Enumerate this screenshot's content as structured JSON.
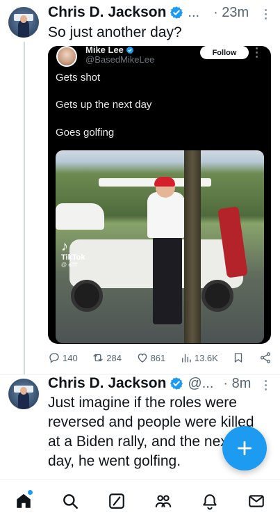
{
  "colors": {
    "accent": "#1d9bf0",
    "text": "#0f1419",
    "secondary": "#536471",
    "verified": "#1d9bf0"
  },
  "tweet1": {
    "author_name": "Chris D. Jackson",
    "handle": "...",
    "time": "· 23m",
    "text": "So just another day?",
    "quoted": {
      "author_name": "Mike Lee",
      "handle": "@BasedMikeLee",
      "follow_label": "Follow",
      "lines": [
        "Gets shot",
        "Gets up the next day",
        "Goes golfing"
      ],
      "video_watermark": "TikTok",
      "video_watermark_tag": "@ effff"
    },
    "actions": {
      "replies": "140",
      "reposts": "284",
      "likes": "861",
      "views": "13.6K"
    }
  },
  "tweet2": {
    "author_name": "Chris D. Jackson",
    "handle": "@...",
    "time": "· 8m",
    "text_lines": [
      "Just imagine if the roles were",
      "reversed and people were killed",
      "at a Biden rally, and the next",
      "day, he went golfing."
    ]
  },
  "fab": {
    "icon": "plus-icon"
  },
  "bottom_nav": {
    "items": [
      "home-icon",
      "search-icon",
      "grok-icon",
      "communities-icon",
      "notifications-icon",
      "messages-icon"
    ]
  }
}
